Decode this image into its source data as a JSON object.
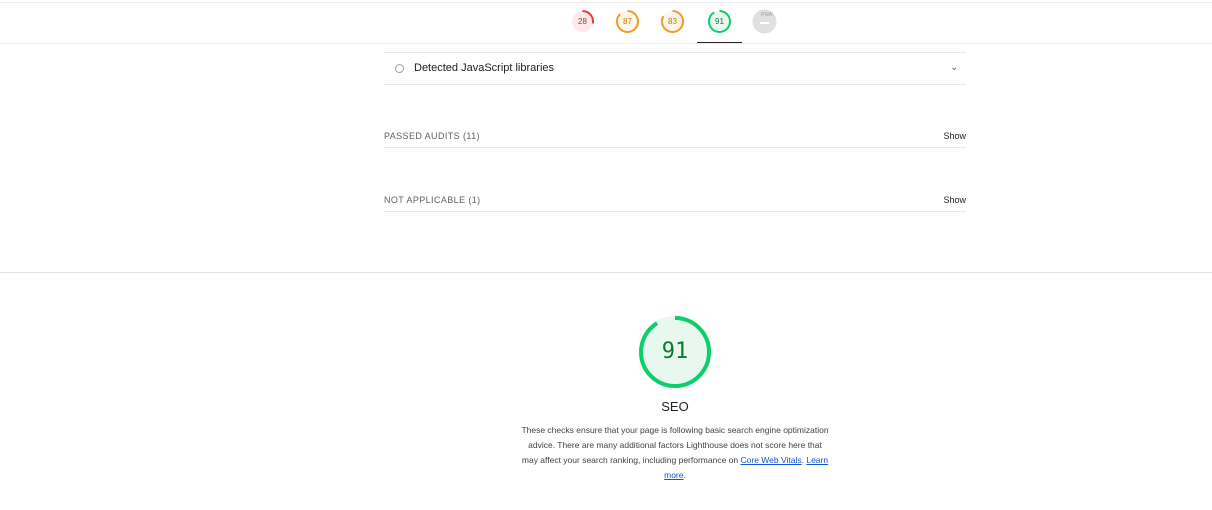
{
  "nav_gauges": [
    {
      "score": "28",
      "color": "#e53935",
      "fill": "#fdeaea",
      "value": 0.28
    },
    {
      "score": "87",
      "color": "#f09a2a",
      "fill": "#fff6ea",
      "value": 0.87
    },
    {
      "score": "83",
      "color": "#f09a2a",
      "fill": "#fff6ea",
      "value": 0.83
    },
    {
      "score": "91",
      "color": "#0cce6b",
      "fill": "#e9f8ef",
      "value": 0.91
    },
    {
      "score": "PWA",
      "color": "#bdbdbd",
      "fill": "#e0e0e0",
      "value": 0
    }
  ],
  "audit": {
    "title": "Detected JavaScript libraries"
  },
  "groups": {
    "passed": {
      "label": "PASSED AUDITS (11)",
      "action": "Show"
    },
    "not_applicable": {
      "label": "NOT APPLICABLE (1)",
      "action": "Show"
    }
  },
  "category": {
    "score": "91",
    "score_value": 0.91,
    "title": "SEO",
    "color": "#0cce6b",
    "desc_text": "These checks ensure that your page is following basic search engine optimization advice. There are many additional factors Lighthouse does not score here that may affect your search ranking, including performance on ",
    "link_cwv": "Core Web Vitals",
    "sep": ". ",
    "link_learn": "Learn more",
    "end": "."
  }
}
